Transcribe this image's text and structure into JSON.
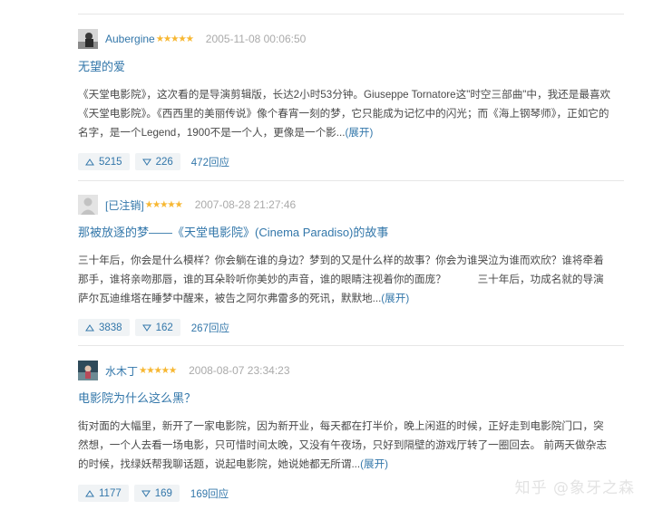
{
  "reviews": [
    {
      "author": "Aubergine",
      "stars": "★★★★★",
      "date": "2005-11-08 00:06:50",
      "title": "无望的爱",
      "body": "《天堂电影院》，这次看的是导演剪辑版，长达2小时53分钟。Giuseppe Tornatore这\"时空三部曲\"中，我还是最喜欢《天堂电影院》。《西西里的美丽传说》像个春宵一刻的梦，它只能成为记忆中的闪光；而《海上钢琴师》，正如它的名字，是一个Legend，1900不是一个人，更像是一个影...",
      "expand": "(展开)",
      "useful": "5215",
      "useless": "226",
      "replies": "472回应"
    },
    {
      "author": "[已注销]",
      "stars": "★★★★★",
      "date": "2007-08-28 21:27:46",
      "title": "那被放逐的梦——《天堂电影院》(Cinema Paradiso)的故事",
      "body": "三十年后，你会是什么模样？你会躺在谁的身边？梦到的又是什么样的故事？你会为谁哭泣为谁而欢欣？谁将牵着那手，谁将亲吻那唇，谁的耳朵聆听你美妙的声音，谁的眼睛注视着你的面庞？　　　三十年后，功成名就的导演萨尔瓦迪维塔在睡梦中醒来，被告之阿尔弗雷多的死讯，默默地...",
      "expand": "(展开)",
      "useful": "3838",
      "useless": "162",
      "replies": "267回应"
    },
    {
      "author": "水木丁",
      "stars": "★★★★★",
      "date": "2008-08-07 23:34:23",
      "title": "电影院为什么这么黑？",
      "body": "街对面的大幅里，新开了一家电影院，因为新开业，每天都在打半价，晚上闲逛的时候，正好走到电影院门口，突然想，一个人去看一场电影，只可惜时间太晚，又没有午夜场，只好到隔壁的游戏厅转了一圈回去。 前两天做杂志的时候，找绿妖帮我聊话题，说起电影院，她说她都无所谓...",
      "expand": "(展开)",
      "useful": "1177",
      "useless": "169",
      "replies": "169回应"
    }
  ],
  "watermark": "知乎 @象牙之森",
  "colors": {
    "link": "#3377aa",
    "star": "#f7b731",
    "vote_bg": "#f0f3f5",
    "meta": "#aaaaaa"
  }
}
